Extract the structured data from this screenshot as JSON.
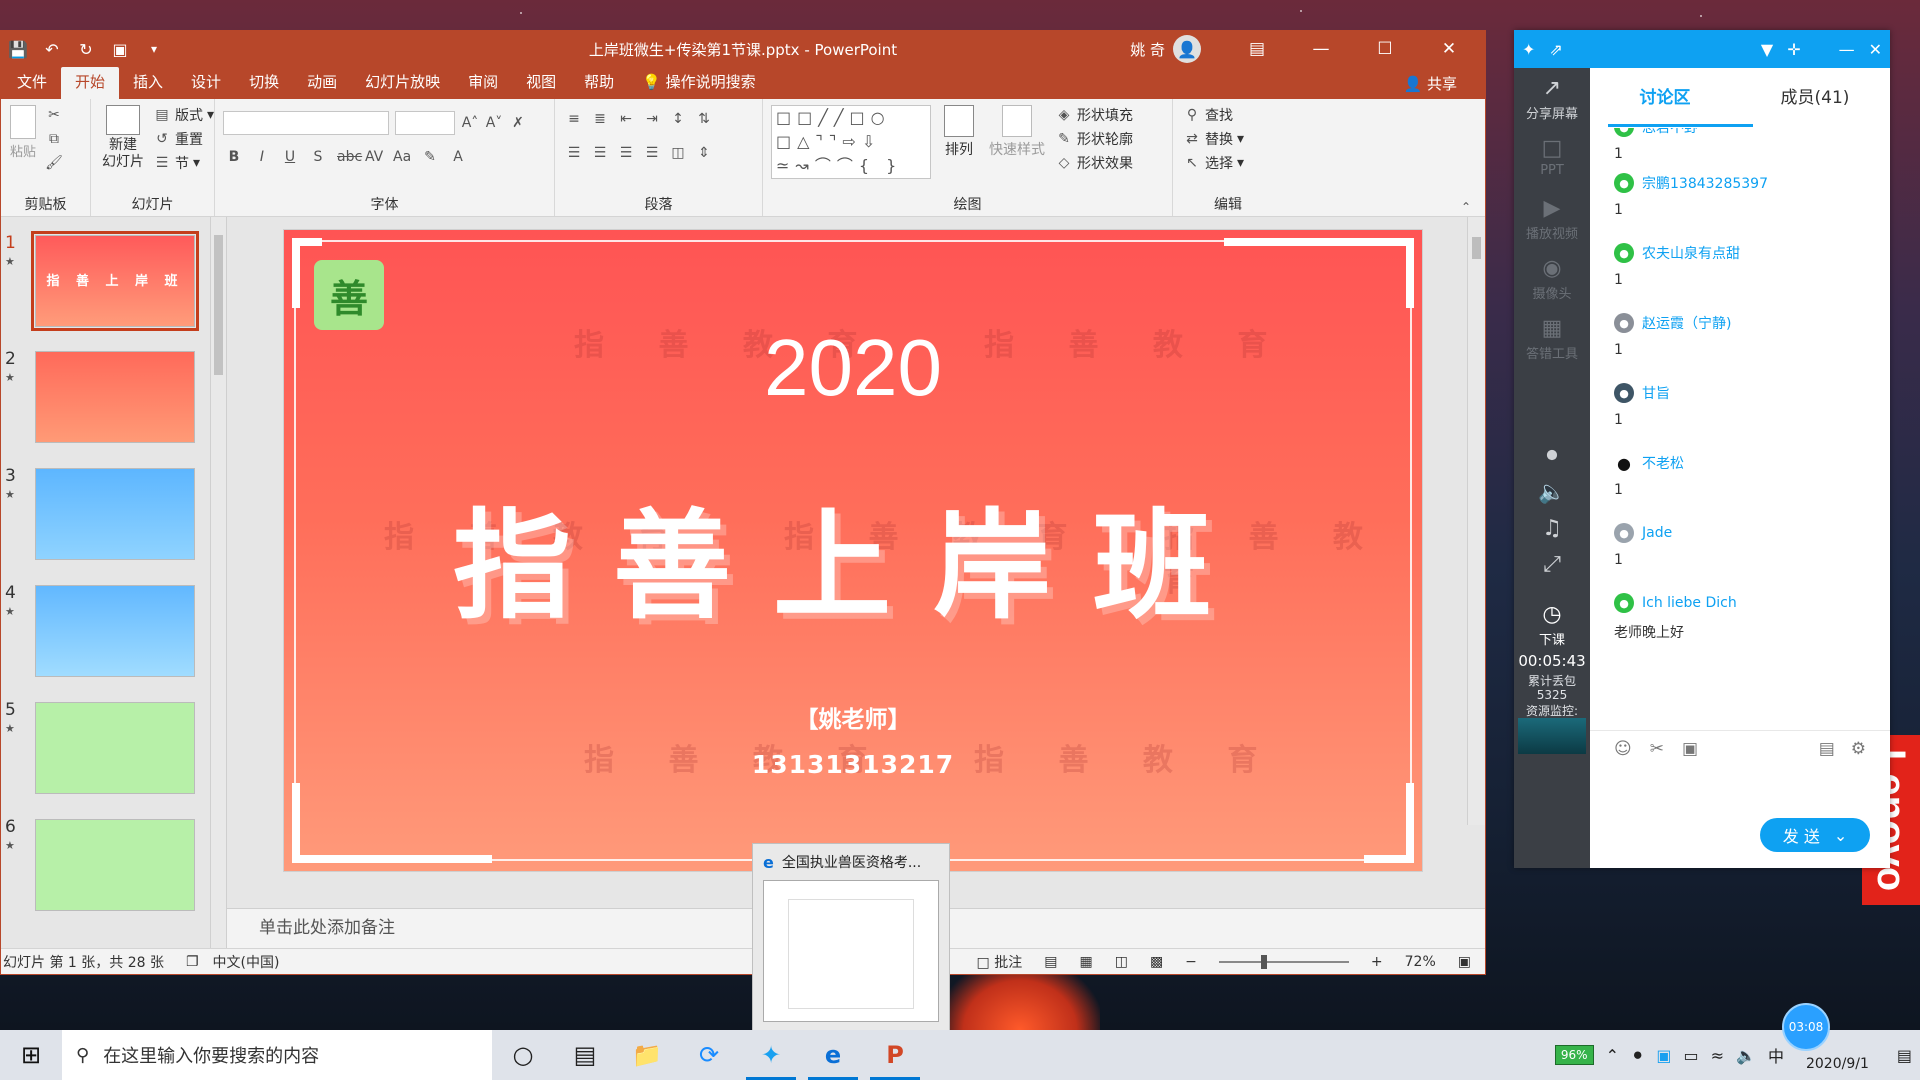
{
  "window": {
    "title": "上岸班微生+传染第1节课.pptx - PowerPoint",
    "user_name": "姚 奇",
    "share_label": "共享"
  },
  "tabs": [
    "文件",
    "开始",
    "插入",
    "设计",
    "切换",
    "动画",
    "幻灯片放映",
    "审阅",
    "视图",
    "帮助"
  ],
  "active_tab_index": 1,
  "tell_me": "操作说明搜索",
  "ribbon": {
    "clipboard": {
      "paste": "粘贴",
      "label": "剪贴板"
    },
    "slides": {
      "new_slide": "新建\n幻灯片",
      "layout": "版式",
      "reset": "重置",
      "section": "节",
      "label": "幻灯片"
    },
    "font": {
      "label": "字体"
    },
    "paragraph": {
      "label": "段落"
    },
    "drawing": {
      "arrange": "排列",
      "quick_styles": "快速样式",
      "shape_fill": "形状填充",
      "shape_outline": "形状轮廓",
      "shape_effects": "形状效果",
      "label": "绘图"
    },
    "editing": {
      "find": "查找",
      "replace": "替换",
      "select": "选择",
      "label": "编辑"
    }
  },
  "thumbnails": [
    {
      "num": "1",
      "text": "指 善 上 岸 班",
      "style": "t1",
      "selected": true
    },
    {
      "num": "2",
      "text": "",
      "style": "t2",
      "selected": false
    },
    {
      "num": "3",
      "text": "",
      "style": "t3",
      "selected": false
    },
    {
      "num": "4",
      "text": "",
      "style": "t4",
      "selected": false
    },
    {
      "num": "5",
      "text": "",
      "style": "t5",
      "selected": false
    },
    {
      "num": "6",
      "text": "",
      "style": "t6",
      "selected": false
    }
  ],
  "slide": {
    "year": "2020",
    "title": "指善上岸班",
    "teacher": "【姚老师】",
    "phone": "13131313217",
    "watermark": "指 善 教 育",
    "logo_char": "善"
  },
  "notes_placeholder": "单击此处添加备注",
  "status": {
    "slide_info": "幻灯片 第 1 张，共 28 张",
    "language": "中文(中国)",
    "comments": "批注",
    "zoom": "72%"
  },
  "chat": {
    "tabs": [
      "讨论区",
      "成员(41)"
    ],
    "side_items": [
      "分享屏幕",
      "PPT",
      "播放视频",
      "摄像头",
      "答错工具",
      "下课"
    ],
    "messages": [
      {
        "user": "思君不野",
        "text": "1",
        "avatar": "wechat"
      },
      {
        "user": "宗鹏13843285397",
        "text": "1",
        "avatar": "wechat"
      },
      {
        "user": "农夫山泉有点甜",
        "text": "1",
        "avatar": "wechat"
      },
      {
        "user": "赵运霞（宁静)",
        "text": "1",
        "avatar": "photo"
      },
      {
        "user": "甘旨",
        "text": "1",
        "avatar": "photo"
      },
      {
        "user": "不老松",
        "text": "1",
        "avatar": "qq"
      },
      {
        "user": "Jade",
        "text": "1",
        "avatar": "photo"
      },
      {
        "user": "Ich liebe Dich",
        "text": "老师晚上好",
        "avatar": "wechat"
      }
    ],
    "send": "发 送",
    "timer": "00:05:43",
    "drop_label": "累计丢包\n5325",
    "monitor_label": "资源监控:"
  },
  "preview": {
    "title": "全国执业兽医资格考..."
  },
  "taskbar": {
    "search_placeholder": "在这里输入你要搜索的内容",
    "battery": "96%",
    "ime": "中",
    "time": "03:08",
    "date": "2020/9/1"
  }
}
